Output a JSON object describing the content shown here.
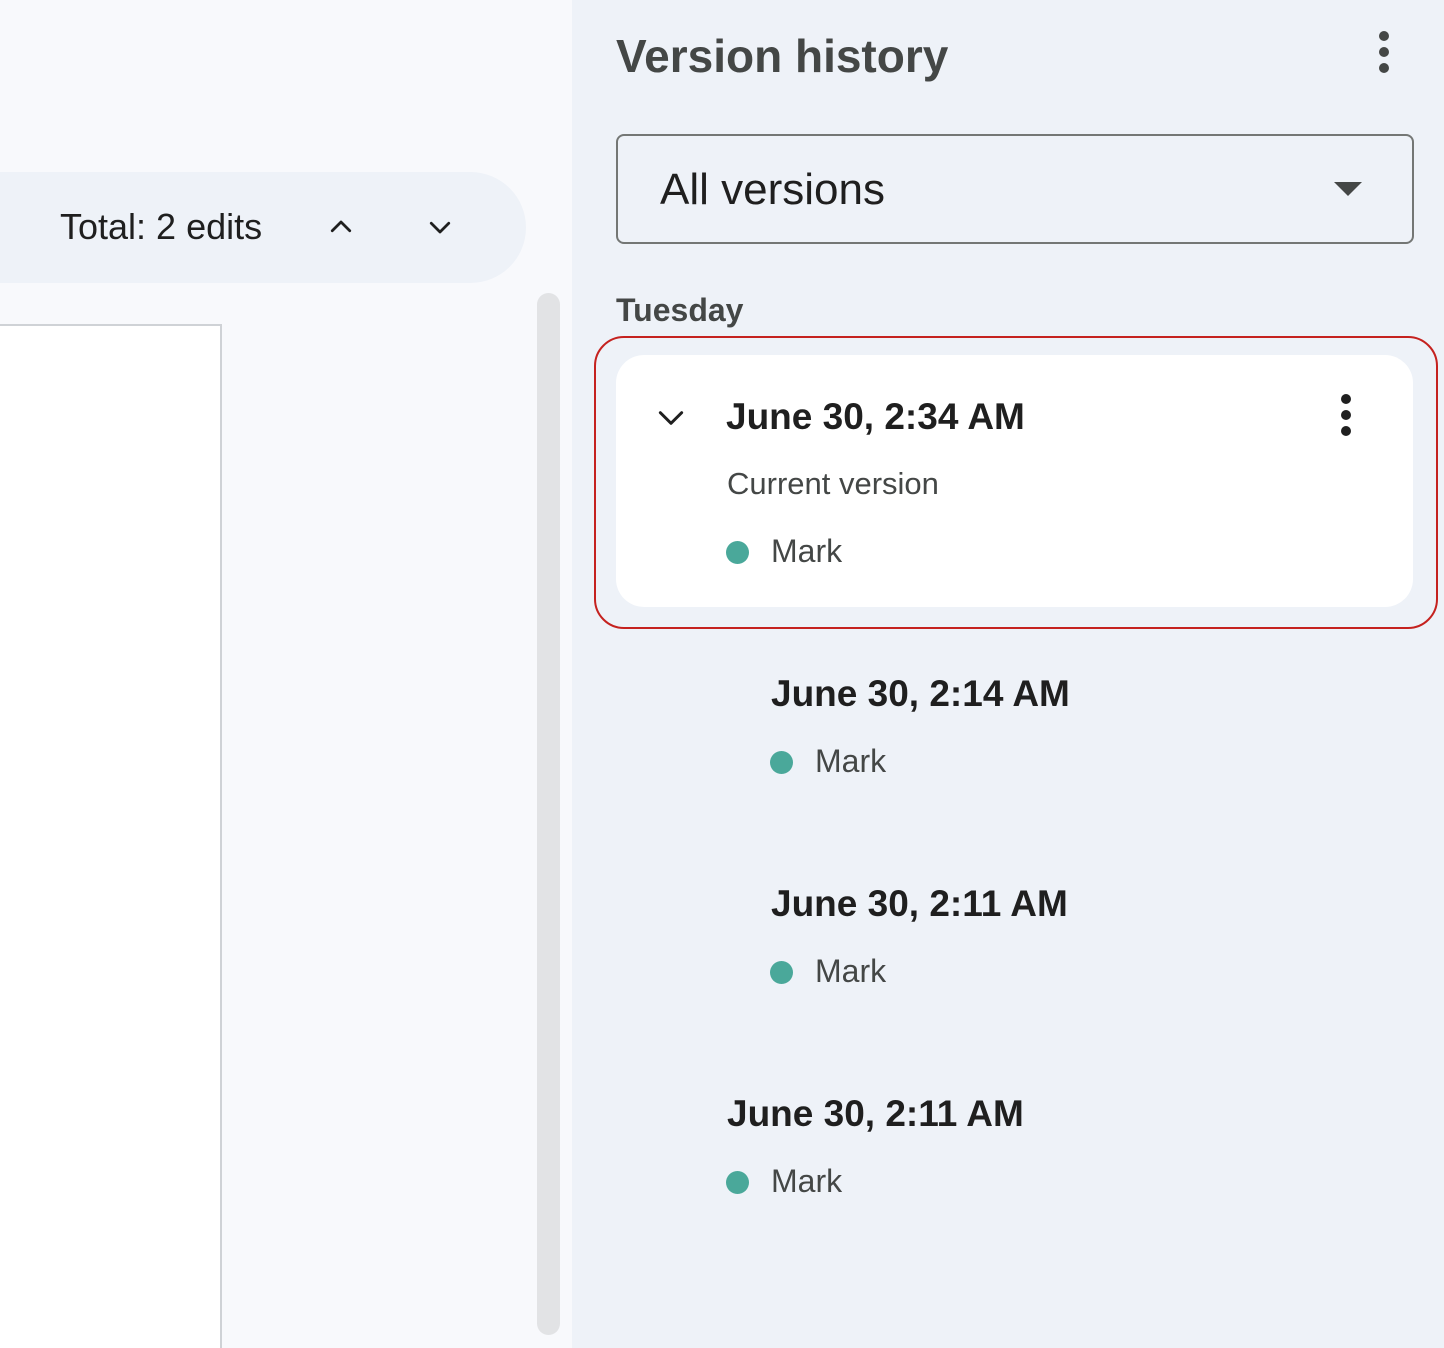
{
  "edits": {
    "total_label": "Total: 2 edits"
  },
  "panel": {
    "title": "Version history",
    "filter": {
      "selected": "All versions"
    },
    "group_label": "Tuesday",
    "versions": [
      {
        "timestamp": "June 30, 2:34 AM",
        "subtitle": "Current version",
        "author": "Mark"
      },
      {
        "timestamp": "June 30, 2:14 AM",
        "author": "Mark"
      },
      {
        "timestamp": "June 30, 2:11 AM",
        "author": "Mark"
      },
      {
        "timestamp": "June 30, 2:11 AM",
        "author": "Mark"
      }
    ]
  },
  "colors": {
    "author_dot": "#4aa89a",
    "highlight": "#c5221f",
    "panel_bg": "#eef2f8"
  },
  "icons": {
    "prev": "chevron-up-icon",
    "next": "chevron-down-icon",
    "more": "more-vert-icon",
    "dropdown": "caret-down-icon",
    "expand": "chevron-down-icon"
  }
}
